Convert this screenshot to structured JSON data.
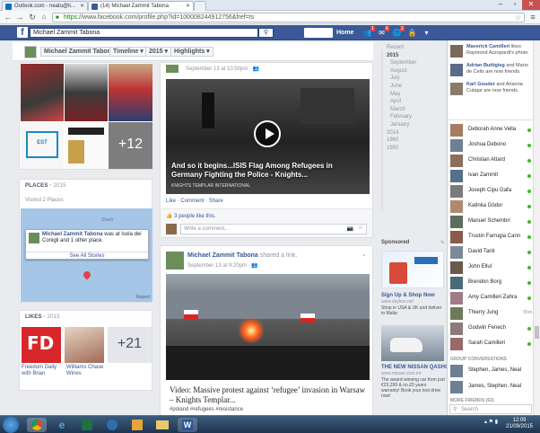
{
  "browser": {
    "tabs": [
      {
        "label": "Outlook.com - neatu@li..."
      },
      {
        "label": "(14) Michael Zammit Tabona"
      }
    ],
    "url_https": "https",
    "url_rest": "://www.facebook.com/profile.php?id=100008244912756&fref=ts"
  },
  "fb": {
    "logo": "f",
    "search_value": "Michael Zammit Tabona",
    "home_label": "Home",
    "badges": [
      "1",
      "6",
      "2"
    ]
  },
  "subnav": {
    "name": "Michael Zammit Tabona",
    "timeline": "Timeline",
    "year": "2015",
    "highlights": "Highlights"
  },
  "photos": {
    "more_count": "+12"
  },
  "places": {
    "title": "PLACES",
    "year": "2015",
    "visited": "Visited 2 Places",
    "tip_name": "Michael Zammit Tabona",
    "tip_text": " was at Isola dei Conigli and 1 other place.",
    "tip_link": "See All Stories",
    "map_label": "Sharri",
    "map_report": "Report"
  },
  "likes": {
    "title": "LIKES",
    "year": "2015",
    "items": [
      {
        "caption": "Freedom Daily with Brian",
        "logo_text": "FD"
      },
      {
        "caption": "Williams Chase Wines"
      }
    ],
    "more_count": "+21"
  },
  "post1": {
    "time": "September 13 at 10:50pm",
    "headline": "And so it begins...ISIS Flag Among Refugees in Germany Fighting the Police - Knights...",
    "source": "KNIGHTS TEMPLAR INTERNATIONAL",
    "actions": [
      "Like",
      "Comment",
      "Share"
    ],
    "likes_text": "3 people like this.",
    "comment_placeholder": "Write a comment..."
  },
  "post2": {
    "name": "Michael Zammit Tabona",
    "action": " shared a link.",
    "time": "September 13 at 9:20pm",
    "title": "Video: Massive protest against ‘refugee’ invasion in Warsaw – Knights Templar...",
    "tags": "#poland #refugees #resistance"
  },
  "timeline_nav": {
    "items": [
      {
        "label": "Recent"
      },
      {
        "label": "2015"
      },
      {
        "label": "September"
      },
      {
        "label": "August"
      },
      {
        "label": "July"
      },
      {
        "label": "June"
      },
      {
        "label": "May"
      },
      {
        "label": "April"
      },
      {
        "label": "March"
      },
      {
        "label": "February"
      },
      {
        "label": "January"
      },
      {
        "label": "2014"
      },
      {
        "label": "1960"
      },
      {
        "label": "1950"
      }
    ]
  },
  "ads": {
    "sponsored": "Sponsored",
    "ad1_title": "Sign Up & Shop Now",
    "ad1_domain": "www.skybox.net",
    "ad1_text": "Shop in USA & UK and deliver to Malta",
    "ad2_title": "THE NEW NISSAN QASHQAI",
    "ad2_domain": "www.nissan.com.mt",
    "ad2_text": "The award winning car from just €23,299 & no £5 years warranty! Book your test drive now!"
  },
  "ticker": [
    {
      "name": "Maverick Camilleri",
      "text": " likes Raymond Azzopardi's photo."
    },
    {
      "name": "Adrian Buttigieg",
      "text": " and Mario de Celis are now friends."
    },
    {
      "name": "Karl Gouder",
      "text": " and Arianna Cutajar are now friends."
    }
  ],
  "chat": {
    "contacts": [
      {
        "name": "Deborah Anne Vella",
        "status": "online"
      },
      {
        "name": "Joshua Debono",
        "status": "online"
      },
      {
        "name": "Christian Attard",
        "status": "online"
      },
      {
        "name": "Ivan Zammit",
        "status": "online"
      },
      {
        "name": "Joseph Cipu Gafa",
        "status": "online"
      },
      {
        "name": "Katinka Gödor",
        "status": "online"
      },
      {
        "name": "Manuel Schembri",
        "status": "online"
      },
      {
        "name": "Trustin Farrugia Cann",
        "status": "online"
      },
      {
        "name": "David Tanti",
        "status": "online"
      },
      {
        "name": "John Ellul",
        "status": "online"
      },
      {
        "name": "Brendon Borg",
        "status": "online"
      },
      {
        "name": "Amy Camilleri Zahra",
        "status": "online"
      },
      {
        "name": "Thierry Jung",
        "status": "55m"
      },
      {
        "name": "Godwin Fenech",
        "status": "online"
      },
      {
        "name": "Sarah Camilleri",
        "status": "online"
      }
    ],
    "group_header": "GROUP CONVERSATIONS",
    "groups": [
      {
        "name": "Stephen, James, Neal"
      },
      {
        "name": "James, Stephen, Neal"
      }
    ],
    "more_friends": "MORE FRIENDS (63)",
    "search_placeholder": "Search"
  },
  "taskbar": {
    "time": "12:09",
    "date": "21/09/2015"
  }
}
